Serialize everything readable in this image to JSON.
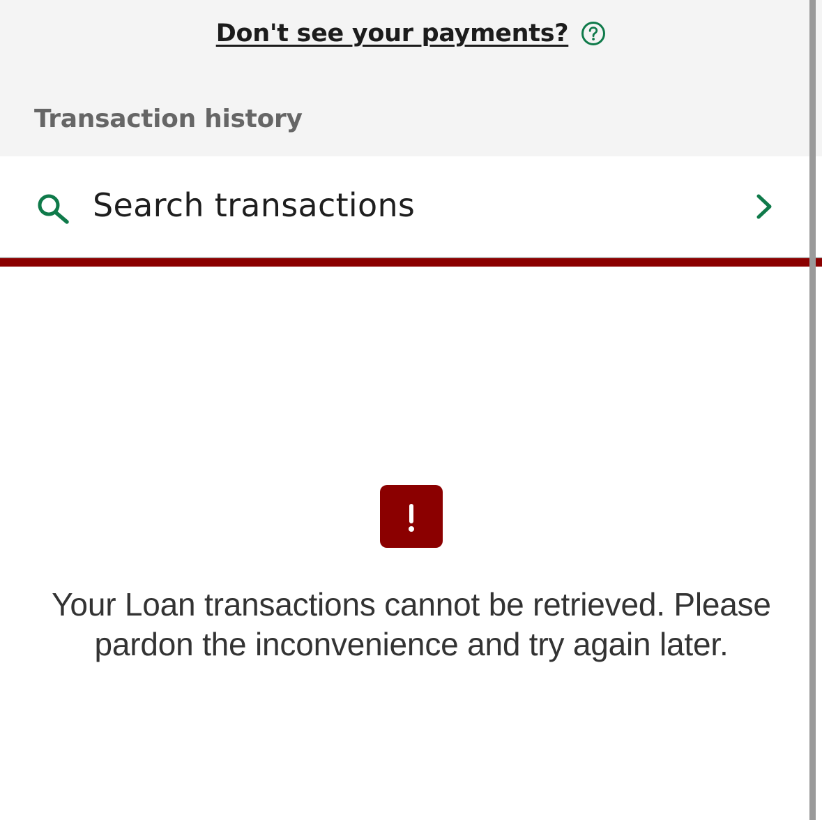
{
  "payments_help": {
    "link_text": "Don't see your payments?",
    "icon": "help-circle-icon"
  },
  "transaction_history": {
    "title": "Transaction history"
  },
  "search": {
    "label": "Search transactions",
    "icon": "search-icon",
    "trailing_icon": "chevron-right-icon"
  },
  "error": {
    "icon": "alert-icon",
    "message": "Your Loan transactions cannot be retrieved. Please pardon the inconvenience and try again later."
  },
  "colors": {
    "accent_green": "#0f7a4a",
    "error_red": "#8b0000",
    "header_background": "#f4f4f4"
  }
}
